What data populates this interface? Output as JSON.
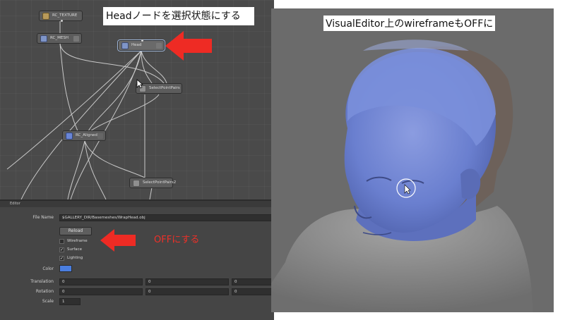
{
  "graph": {
    "nodes": {
      "rc_texture": "RC_TEXTURE",
      "rc_mesh": "RC_MESH",
      "head": "Head",
      "select_point_pairs": "SelectPointPairs",
      "rc_aligned": "RC_Aligned",
      "select_point_pairs2": "SelectPointPairs2"
    },
    "annotation": "Headノードを選択状態にする"
  },
  "editor": {
    "tab_label": "Editor",
    "file_name_label": "File Name",
    "file_name_value": "$GALLERY_DIR/Basemeshes/WrapHead.obj",
    "reload_label": "Reload",
    "wireframe_label": "Wireframe",
    "surface_label": "Surface",
    "lighting_label": "Lighting",
    "wireframe_checked": false,
    "surface_checked": true,
    "lighting_checked": true,
    "color_label": "Color",
    "color_value": "#4a7ee0",
    "translation_label": "Translation",
    "translation": [
      "0",
      "0",
      "0"
    ],
    "rotation_label": "Rotation",
    "rotation": [
      "0",
      "0",
      "0"
    ],
    "scale_label": "Scale",
    "scale": "1",
    "annotation": "OFFにする"
  },
  "viewport": {
    "annotation": "VisualEditor上のwireframeもOFFに"
  },
  "colors": {
    "arrow": "#ee2b24",
    "mesh": "#6f86d6"
  }
}
